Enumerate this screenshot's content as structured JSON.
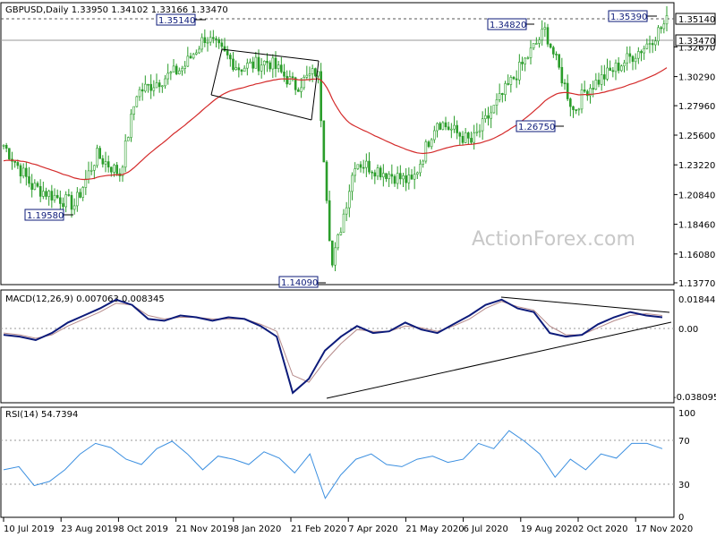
{
  "header": {
    "symbol": "GBPUSD,Daily",
    "open": "1.33950",
    "high": "1.34102",
    "low": "1.33166",
    "close": "1.33470"
  },
  "watermark": "ActionForex.com",
  "colors": {
    "candle": "#2a9d2a",
    "ma": "#d42a2a",
    "macd": "#0d1b7a",
    "signal": "#b58a8a",
    "rsi": "#3b8fe0",
    "box": "#0d1b7a"
  },
  "chart_data": [
    {
      "type": "candlestick",
      "panel": "price",
      "ylim": [
        1.1377,
        1.3614
      ],
      "y_ticks": [
        "1.35140",
        "1.32670",
        "1.30290",
        "1.27960",
        "1.25600",
        "1.23220",
        "1.20840",
        "1.18460",
        "1.16080",
        "1.13770"
      ],
      "current_price": "1.33470",
      "reference_level": "1.35140",
      "moving_average": "EMA(55), red line",
      "callouts": [
        {
          "label": "1.35140",
          "date": "26 Nov 2019",
          "value": 1.3514
        },
        {
          "label": "1.19580",
          "date": "3 Sep 2019",
          "value": 1.1958
        },
        {
          "label": "1.14090",
          "date": "20 Mar 2020",
          "value": 1.1409
        },
        {
          "label": "1.34820",
          "date": "1 Sep 2020",
          "value": 1.3482
        },
        {
          "label": "1.26750",
          "date": "23 Sep 2020",
          "value": 1.2675
        },
        {
          "label": "1.35390",
          "date": "4 Dec 2020",
          "value": 1.3539
        }
      ],
      "close_trend": [
        [
          "10 Jul 2019",
          1.248
        ],
        [
          "1 Aug 2019",
          1.215
        ],
        [
          "3 Sep 2019",
          1.2
        ],
        [
          "20 Sep 2019",
          1.24
        ],
        [
          "8 Oct 2019",
          1.225
        ],
        [
          "21 Oct 2019",
          1.29
        ],
        [
          "26 Nov 2019",
          1.31
        ],
        [
          "13 Dec 2019",
          1.335
        ],
        [
          "8 Jan 2020",
          1.31
        ],
        [
          "31 Jan 2020",
          1.315
        ],
        [
          "21 Feb 2020",
          1.295
        ],
        [
          "9 Mar 2020",
          1.308
        ],
        [
          "20 Mar 2020",
          1.15
        ],
        [
          "7 Apr 2020",
          1.235
        ],
        [
          "21 May 2020",
          1.218
        ],
        [
          "9 Jun 2020",
          1.268
        ],
        [
          "6 Jul 2020",
          1.25
        ],
        [
          "19 Aug 2020",
          1.32
        ],
        [
          "1 Sep 2020",
          1.34
        ],
        [
          "23 Sep 2020",
          1.275
        ],
        [
          "2 Oct 2020",
          1.292
        ],
        [
          "17 Nov 2020",
          1.327
        ],
        [
          "4 Dec 2020",
          1.347
        ]
      ]
    },
    {
      "type": "line",
      "panel": "macd",
      "title": "MACD(12,26,9) 0.007063 0.008345",
      "ylim": [
        -0.038095,
        0.018442
      ],
      "y_ticks": [
        "0.018442",
        "0.00",
        "-0.038095"
      ],
      "series": [
        {
          "name": "MACD",
          "values": [
            -0.003,
            -0.004,
            -0.006,
            -0.002,
            0.004,
            0.008,
            0.012,
            0.017,
            0.014,
            0.006,
            0.005,
            0.008,
            0.007,
            0.005,
            0.007,
            0.006,
            0.002,
            -0.004,
            -0.036,
            -0.028,
            -0.012,
            -0.004,
            0.002,
            -0.002,
            -0.001,
            0.004,
            0.0,
            -0.002,
            0.003,
            0.008,
            0.014,
            0.017,
            0.012,
            0.01,
            -0.002,
            -0.004,
            -0.003,
            0.003,
            0.007,
            0.01,
            0.008,
            0.007
          ]
        },
        {
          "name": "Signal",
          "values": [
            -0.002,
            -0.003,
            -0.005,
            -0.003,
            0.002,
            0.006,
            0.01,
            0.015,
            0.014,
            0.008,
            0.006,
            0.007,
            0.007,
            0.006,
            0.006,
            0.006,
            0.003,
            -0.001,
            -0.026,
            -0.03,
            -0.018,
            -0.008,
            0.0,
            -0.001,
            -0.001,
            0.002,
            0.001,
            -0.001,
            0.002,
            0.006,
            0.012,
            0.016,
            0.013,
            0.011,
            0.002,
            -0.003,
            -0.003,
            0.001,
            0.005,
            0.008,
            0.009,
            0.008
          ]
        }
      ]
    },
    {
      "type": "line",
      "panel": "rsi",
      "title": "RSI(14) 54.7394",
      "ylim": [
        0,
        100
      ],
      "y_ticks": [
        "100",
        "70",
        "30",
        "0"
      ],
      "series": [
        {
          "name": "RSI",
          "values": [
            45,
            48,
            30,
            34,
            45,
            60,
            70,
            66,
            55,
            50,
            65,
            72,
            60,
            45,
            58,
            55,
            50,
            62,
            56,
            42,
            60,
            18,
            40,
            55,
            60,
            50,
            48,
            55,
            58,
            52,
            55,
            70,
            65,
            82,
            72,
            60,
            38,
            55,
            45,
            60,
            56,
            70,
            70,
            65
          ]
        }
      ]
    }
  ],
  "x_axis": {
    "labels": [
      "10 Jul 2019",
      "23 Aug 2019",
      "8 Oct 2019",
      "21 Nov 2019",
      "8 Jan 2020",
      "21 Feb 2020",
      "7 Apr 2020",
      "21 May 2020",
      "6 Jul 2020",
      "19 Aug 2020",
      "2 Oct 2020",
      "17 Nov 2020"
    ]
  }
}
